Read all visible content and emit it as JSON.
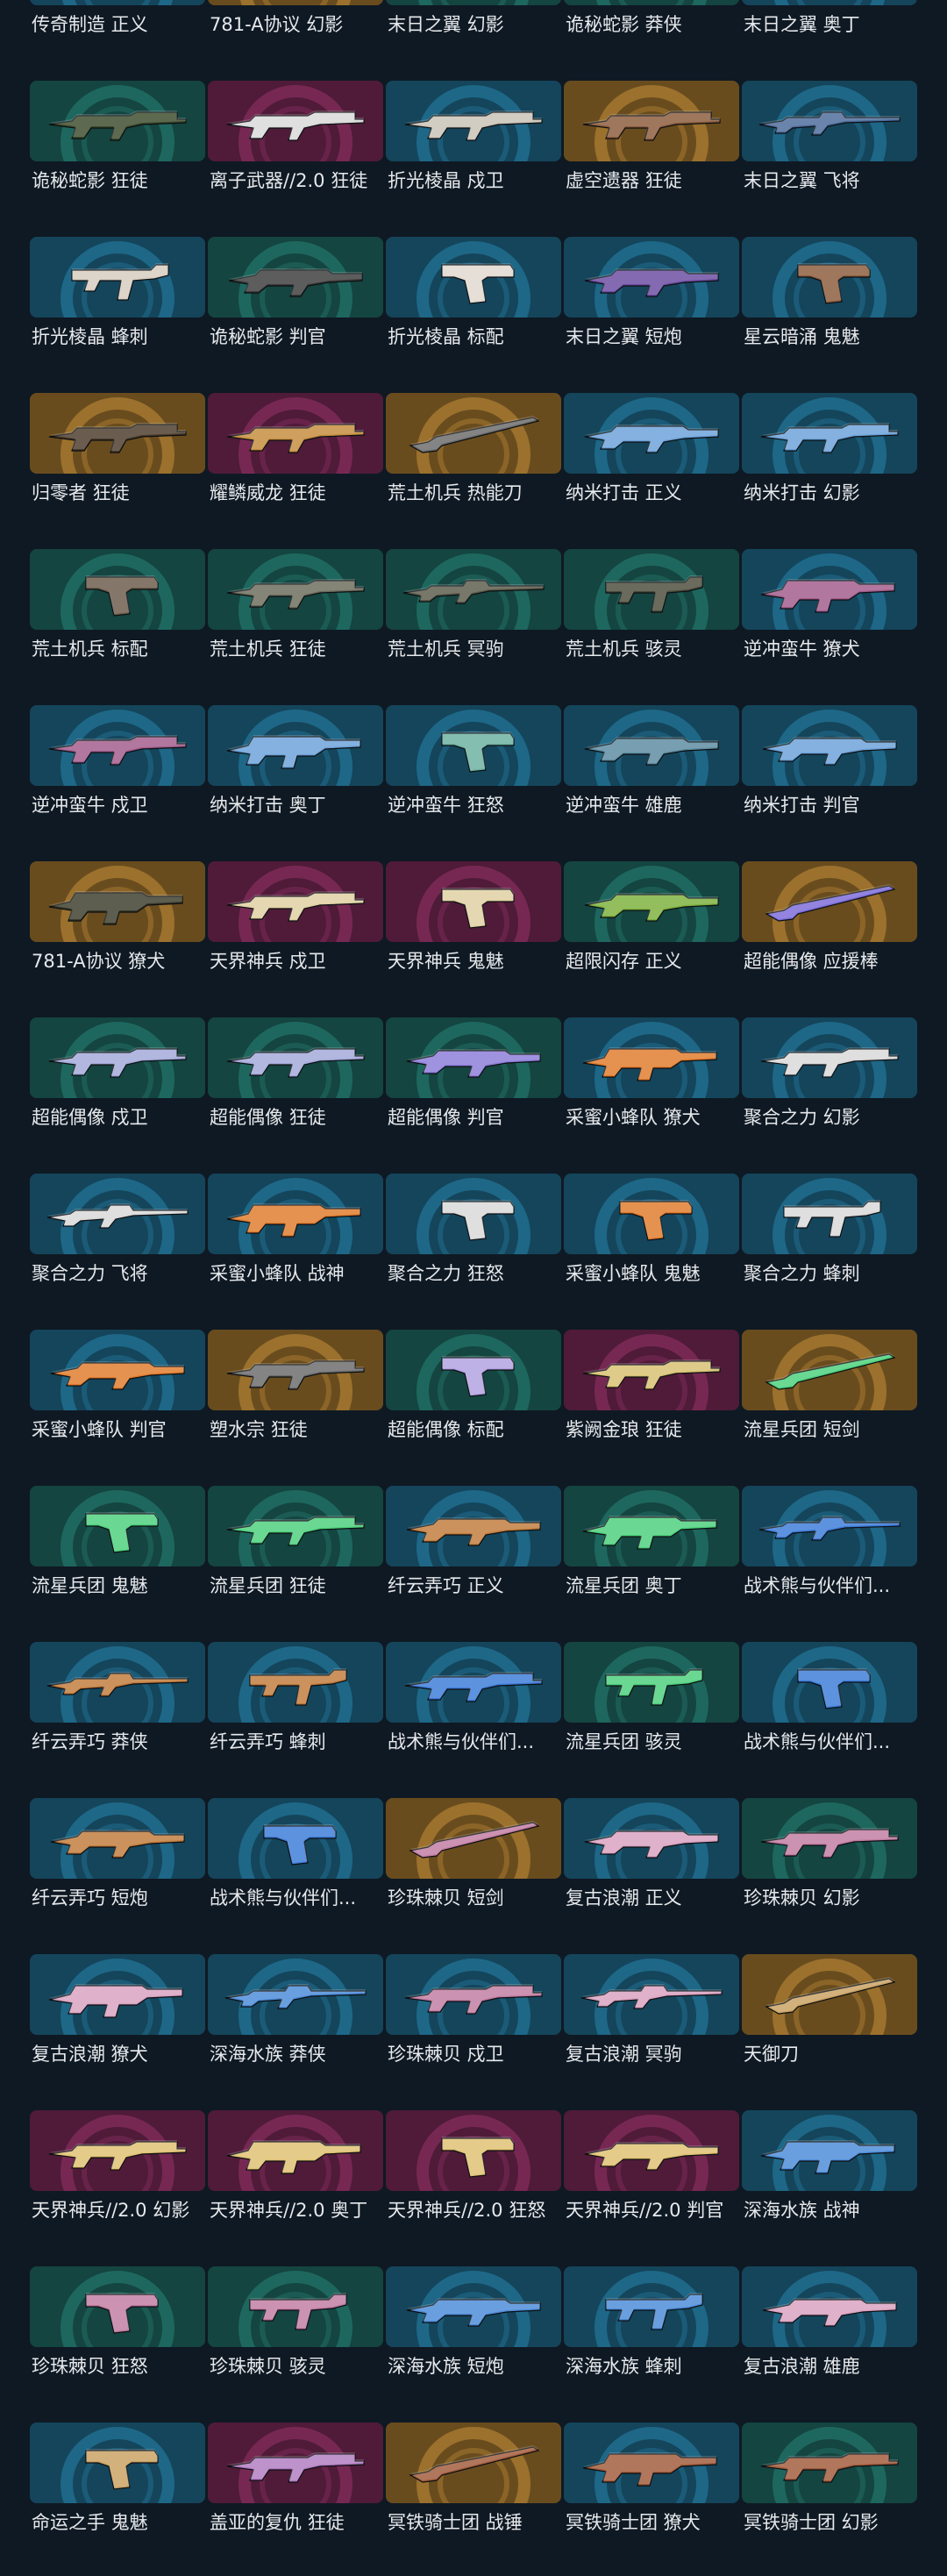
{
  "tier_colors": {
    "deluxe": "#1f6a63",
    "premium": "#7a2a57",
    "exclusive": "#a1752f",
    "select": "#1f6a8c",
    "ultra": "#b8923a"
  },
  "skins": [
    {
      "name": "传奇制造 正义",
      "tier": "select",
      "gun": "rifle",
      "accent": "#6fd1c9"
    },
    {
      "name": "781-A协议 幻影",
      "tier": "exclusive",
      "gun": "rifle",
      "accent": "#6b6b4a"
    },
    {
      "name": "末日之翼 幻影",
      "tier": "deluxe",
      "gun": "rifle",
      "accent": "#5b7fb0"
    },
    {
      "name": "诡秘蛇影 莽侠",
      "tier": "deluxe",
      "gun": "sniper",
      "accent": "#4a5a3a"
    },
    {
      "name": "末日之翼 奥丁",
      "tier": "select",
      "gun": "lmg",
      "accent": "#9a5a2a"
    },
    {
      "name": "诡秘蛇影 狂徒",
      "tier": "deluxe",
      "gun": "rifle",
      "accent": "#3a4a2a"
    },
    {
      "name": "离子武器//2.0 狂徒",
      "tier": "premium",
      "gun": "rifle",
      "accent": "#d8d8d8"
    },
    {
      "name": "折光棱晶 戍卫",
      "tier": "select",
      "gun": "rifle",
      "accent": "#c9c2b6"
    },
    {
      "name": "虚空遗器 狂徒",
      "tier": "exclusive",
      "gun": "rifle",
      "accent": "#8a5a3a"
    },
    {
      "name": "末日之翼 飞将",
      "tier": "select",
      "gun": "sniper",
      "accent": "#4a6a9a"
    },
    {
      "name": "折光棱晶 蜂刺",
      "tier": "select",
      "gun": "smg",
      "accent": "#d6cbbf"
    },
    {
      "name": "诡秘蛇影 判官",
      "tier": "deluxe",
      "gun": "shotgun",
      "accent": "#3a3a3a"
    },
    {
      "name": "折光棱晶 标配",
      "tier": "select",
      "gun": "pistol",
      "accent": "#e0d8cf"
    },
    {
      "name": "末日之翼 短炮",
      "tier": "select",
      "gun": "shotgun",
      "accent": "#6a4aa0"
    },
    {
      "name": "星云暗涌 鬼魅",
      "tier": "select",
      "gun": "pistol",
      "accent": "#8a5a3a"
    },
    {
      "name": "归零者 狂徒",
      "tier": "exclusive",
      "gun": "rifle",
      "accent": "#4a3a2a"
    },
    {
      "name": "耀鳞威龙 狂徒",
      "tier": "premium",
      "gun": "rifle",
      "accent": "#c48a3a"
    },
    {
      "name": "荒土机兵 热能刀",
      "tier": "exclusive",
      "gun": "melee",
      "accent": "#6a6a6a"
    },
    {
      "name": "纳米打击 正义",
      "tier": "select",
      "gun": "shotgun",
      "accent": "#6aa0d8"
    },
    {
      "name": "纳米打击 幻影",
      "tier": "select",
      "gun": "rifle",
      "accent": "#6aa0d8"
    },
    {
      "name": "荒土机兵 标配",
      "tier": "deluxe",
      "gun": "pistol",
      "accent": "#6a5a4a"
    },
    {
      "name": "荒土机兵 狂徒",
      "tier": "deluxe",
      "gun": "rifle",
      "accent": "#6a6a5a"
    },
    {
      "name": "荒土机兵 冥驹",
      "tier": "deluxe",
      "gun": "sniper",
      "accent": "#5a5a4a"
    },
    {
      "name": "荒土机兵 骇灵",
      "tier": "deluxe",
      "gun": "smg",
      "accent": "#4a4a3a"
    },
    {
      "name": "逆冲蛮牛 獠犬",
      "tier": "select",
      "gun": "lmg",
      "accent": "#a05a8a"
    },
    {
      "name": "逆冲蛮牛 戍卫",
      "tier": "select",
      "gun": "rifle",
      "accent": "#a05a8a"
    },
    {
      "name": "纳米打击 奥丁",
      "tier": "select",
      "gun": "lmg",
      "accent": "#6aa0d8"
    },
    {
      "name": "逆冲蛮牛 狂怒",
      "tier": "select",
      "gun": "pistol",
      "accent": "#6ab0a0"
    },
    {
      "name": "逆冲蛮牛 雄鹿",
      "tier": "select",
      "gun": "shotgun",
      "accent": "#5a8aa0"
    },
    {
      "name": "纳米打击 判官",
      "tier": "select",
      "gun": "shotgun",
      "accent": "#6aa0d8"
    },
    {
      "name": "781-A协议 獠犬",
      "tier": "exclusive",
      "gun": "lmg",
      "accent": "#3a3a2a"
    },
    {
      "name": "天界神兵 戍卫",
      "tier": "premium",
      "gun": "rifle",
      "accent": "#e0cfa0"
    },
    {
      "name": "天界神兵 鬼魅",
      "tier": "premium",
      "gun": "pistol",
      "accent": "#e0cfa0"
    },
    {
      "name": "超限闪存 正义",
      "tier": "deluxe",
      "gun": "shotgun",
      "accent": "#7ab03a"
    },
    {
      "name": "超能偶像 应援棒",
      "tier": "exclusive",
      "gun": "melee",
      "accent": "#7a6ad8"
    },
    {
      "name": "超能偶像 戍卫",
      "tier": "deluxe",
      "gun": "rifle",
      "accent": "#a0a8d8"
    },
    {
      "name": "超能偶像 狂徒",
      "tier": "deluxe",
      "gun": "rifle",
      "accent": "#a0a8d8"
    },
    {
      "name": "超能偶像 判官",
      "tier": "deluxe",
      "gun": "shotgun",
      "accent": "#8a7ad8"
    },
    {
      "name": "采蜜小蜂队 獠犬",
      "tier": "select",
      "gun": "lmg",
      "accent": "#e07a2a"
    },
    {
      "name": "聚合之力 幻影",
      "tier": "select",
      "gun": "rifle",
      "accent": "#d8d8d8"
    },
    {
      "name": "聚合之力 飞将",
      "tier": "select",
      "gun": "sniper",
      "accent": "#d8d8d8"
    },
    {
      "name": "采蜜小蜂队 战神",
      "tier": "select",
      "gun": "lmg",
      "accent": "#e07a2a"
    },
    {
      "name": "聚合之力 狂怒",
      "tier": "select",
      "gun": "pistol",
      "accent": "#d8d8d8"
    },
    {
      "name": "采蜜小蜂队 鬼魅",
      "tier": "select",
      "gun": "pistol",
      "accent": "#e07a2a"
    },
    {
      "name": "聚合之力 蜂刺",
      "tier": "select",
      "gun": "smg",
      "accent": "#d8d8d8"
    },
    {
      "name": "采蜜小蜂队 判官",
      "tier": "select",
      "gun": "shotgun",
      "accent": "#e07a2a"
    },
    {
      "name": "塑水宗 狂徒",
      "tier": "exclusive",
      "gun": "rifle",
      "accent": "#6a6a6a"
    },
    {
      "name": "超能偶像 标配",
      "tier": "deluxe",
      "gun": "pistol",
      "accent": "#b0a0e0"
    },
    {
      "name": "紫阙金琅 狂徒",
      "tier": "premium",
      "gun": "rifle",
      "accent": "#d8c070"
    },
    {
      "name": "流星兵团 短剑",
      "tier": "exclusive",
      "gun": "melee",
      "accent": "#4ad07a"
    },
    {
      "name": "流星兵团 鬼魅",
      "tier": "deluxe",
      "gun": "pistol",
      "accent": "#4ad07a"
    },
    {
      "name": "流星兵团 狂徒",
      "tier": "deluxe",
      "gun": "rifle",
      "accent": "#4ad07a"
    },
    {
      "name": "纤云弄巧 正义",
      "tier": "select",
      "gun": "shotgun",
      "accent": "#c07a3a"
    },
    {
      "name": "流星兵团 奥丁",
      "tier": "deluxe",
      "gun": "lmg",
      "accent": "#4ad07a"
    },
    {
      "name": "战术熊与伙伴们...",
      "tier": "select",
      "gun": "sniper",
      "accent": "#3a7ad8"
    },
    {
      "name": "纤云弄巧 莽侠",
      "tier": "select",
      "gun": "sniper",
      "accent": "#c07a3a"
    },
    {
      "name": "纤云弄巧 蜂刺",
      "tier": "select",
      "gun": "smg",
      "accent": "#c07a3a"
    },
    {
      "name": "战术熊与伙伴们...",
      "tier": "select",
      "gun": "rifle",
      "accent": "#3a7ad8"
    },
    {
      "name": "流星兵团 骇灵",
      "tier": "deluxe",
      "gun": "smg",
      "accent": "#4ad07a"
    },
    {
      "name": "战术熊与伙伴们...",
      "tier": "select",
      "gun": "pistol",
      "accent": "#3a7ad8"
    },
    {
      "name": "纤云弄巧 短炮",
      "tier": "select",
      "gun": "shotgun",
      "accent": "#c07a3a"
    },
    {
      "name": "战术熊与伙伴们...",
      "tier": "select",
      "gun": "pistol",
      "accent": "#3a7ad8"
    },
    {
      "name": "珍珠棘贝 短剑",
      "tier": "exclusive",
      "gun": "melee",
      "accent": "#c07aa0"
    },
    {
      "name": "复古浪潮 正义",
      "tier": "select",
      "gun": "shotgun",
      "accent": "#d8a0c0"
    },
    {
      "name": "珍珠棘贝 幻影",
      "tier": "deluxe",
      "gun": "rifle",
      "accent": "#c07aa0"
    },
    {
      "name": "复古浪潮 獠犬",
      "tier": "select",
      "gun": "lmg",
      "accent": "#d8a0c0"
    },
    {
      "name": "深海水族 莽侠",
      "tier": "select",
      "gun": "sniper",
      "accent": "#4a8ad8"
    },
    {
      "name": "珍珠棘贝 戍卫",
      "tier": "select",
      "gun": "rifle",
      "accent": "#c07aa0"
    },
    {
      "name": "复古浪潮 冥驹",
      "tier": "select",
      "gun": "sniper",
      "accent": "#d8a0c0"
    },
    {
      "name": "天御刀",
      "tier": "exclusive",
      "gun": "melee",
      "accent": "#c8a060"
    },
    {
      "name": "天界神兵//2.0 幻影",
      "tier": "premium",
      "gun": "rifle",
      "accent": "#e0c070"
    },
    {
      "name": "天界神兵//2.0 奥丁",
      "tier": "premium",
      "gun": "lmg",
      "accent": "#e0c070"
    },
    {
      "name": "天界神兵//2.0 狂怒",
      "tier": "premium",
      "gun": "pistol",
      "accent": "#e0c070"
    },
    {
      "name": "天界神兵//2.0 判官",
      "tier": "premium",
      "gun": "shotgun",
      "accent": "#e0c070"
    },
    {
      "name": "深海水族 战神",
      "tier": "select",
      "gun": "lmg",
      "accent": "#4a8ad8"
    },
    {
      "name": "珍珠棘贝 狂怒",
      "tier": "deluxe",
      "gun": "pistol",
      "accent": "#c07aa0"
    },
    {
      "name": "珍珠棘贝 骇灵",
      "tier": "deluxe",
      "gun": "smg",
      "accent": "#c07aa0"
    },
    {
      "name": "深海水族 短炮",
      "tier": "select",
      "gun": "shotgun",
      "accent": "#4a8ad8"
    },
    {
      "name": "深海水族 蜂刺",
      "tier": "select",
      "gun": "smg",
      "accent": "#4a8ad8"
    },
    {
      "name": "复古浪潮 雄鹿",
      "tier": "select",
      "gun": "shotgun",
      "accent": "#d8a0c0"
    },
    {
      "name": "命运之手 鬼魅",
      "tier": "select",
      "gun": "pistol",
      "accent": "#c8a060"
    },
    {
      "name": "盖亚的复仇 狂徒",
      "tier": "premium",
      "gun": "rifle",
      "accent": "#b07ac0"
    },
    {
      "name": "冥铁骑士团 战锤",
      "tier": "exclusive",
      "gun": "melee",
      "accent": "#a05a3a"
    },
    {
      "name": "冥铁骑士团 獠犬",
      "tier": "select",
      "gun": "lmg",
      "accent": "#a05a3a"
    },
    {
      "name": "冥铁骑士团 幻影",
      "tier": "deluxe",
      "gun": "rifle",
      "accent": "#a05a3a"
    }
  ]
}
